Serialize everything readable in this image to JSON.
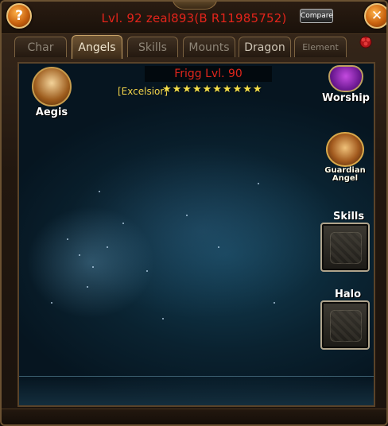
{
  "header": {
    "title": "Lvl. 92 zeal893(B R11985752)",
    "compare_label": "Compare",
    "help_icon": "question-mark",
    "close_icon": "x-mark"
  },
  "tabs": [
    {
      "label": "Char",
      "active": false
    },
    {
      "label": "Angels",
      "active": true
    },
    {
      "label": "Skills",
      "active": false
    },
    {
      "label": "Mounts",
      "active": false
    },
    {
      "label": "Dragon",
      "active": false
    },
    {
      "label": "Element",
      "active": false
    }
  ],
  "angel": {
    "name_level": "Frigg Lvl. 90",
    "rank": "[Excelsior]",
    "stars_count": 10,
    "stars_text": "★★★★★★★★★★"
  },
  "emblems": {
    "aegis_label": "Aegis",
    "worship_label": "Worship",
    "guardian_label_line1": "Guardian",
    "guardian_label_line2": "Angel"
  },
  "side_panels": {
    "skills_label": "Skills",
    "halo_label": "Halo"
  },
  "colors": {
    "title_red": "#e3241b",
    "star_gold": "#f6e04a",
    "frame_bronze": "#6b5232",
    "sky_blue": "#134056"
  }
}
